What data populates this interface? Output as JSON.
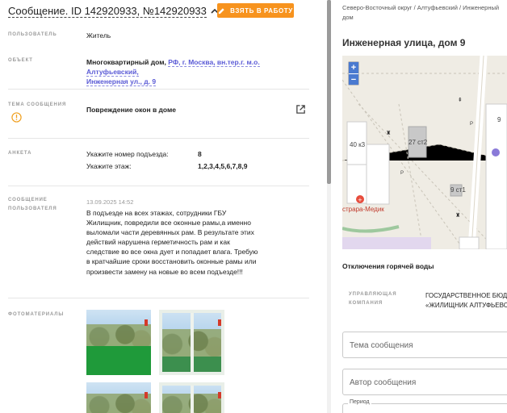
{
  "header": {
    "title": "Сообщение. ID 142920933, №142920933",
    "take_button": "ВЗЯТЬ В РАБОТУ"
  },
  "fields": {
    "user_label": "ПОЛЬЗОВАТЕЛЬ",
    "user_value": "Житель",
    "object_label": "ОБЪЕКТ",
    "object_prefix": "Многоквартирный дом,",
    "object_link_1": "РФ, г. Москва, вн.тер.г. м.о. Алтуфьевский,",
    "object_link_2": "Инженерная ул., д. 9",
    "topic_label": "ТЕМА СООБЩЕНИЯ",
    "topic_value": "Повреждение окон в доме",
    "form_label": "АНКЕТА",
    "form_q1": "Укажите номер подъезда:",
    "form_a1": "8",
    "form_q2": "Укажите этаж:",
    "form_a2": "1,2,3,4,5,6,7,8,9",
    "msg_label_1": "СООБЩЕНИЕ",
    "msg_label_2": "ПОЛЬЗОВАТЕЛЯ",
    "msg_date": "13.09.2025 14:52",
    "msg_text": "В подъезде на всех этажах, сотрудники ГБУ Жилищник, повредили все оконные рамы,а именно выломали части деревянных рам. В результате этих действий нарушена герметичность рам и как следствие во все окна дует и попадает влага. Требую в кратчайшие сроки восстановить оконные рамы или произвести замену на новые во всем подъезде!!!",
    "photos_label": "ФОТОМАТЕРИАЛЫ"
  },
  "right": {
    "breadcrumb": "Северо-Восточный округ / Алтуфьевский / Инженерный дом",
    "address": "Инженерная улица, дом 9",
    "map": {
      "zoom_in": "+",
      "zoom_out": "−",
      "label_40k3": "40 к3",
      "label_27st2": "27 ст2",
      "label_9st1": "9 ст1",
      "label_9": "9",
      "label_p1": "Р",
      "label_p2": "Р",
      "label_medik": "страра-Медик"
    },
    "hot_water": "Отключения горячей воды",
    "uk_label_1": "УПРАВЛЯЮЩАЯ",
    "uk_label_2": "КОМПАНИЯ",
    "uk_value_1": "ГОСУДАРСТВЕННОЕ БЮДЖ",
    "uk_value_2": "«ЖИЛИЩНИК АЛТУФЬЕВС",
    "topic_field": "Тема сообщения",
    "author_field": "Автор сообщения",
    "period_label": "Период"
  },
  "colors": {
    "accent_orange": "#f7931e",
    "link_purple": "#5b5bd6",
    "warning_orange": "#f0a020"
  }
}
